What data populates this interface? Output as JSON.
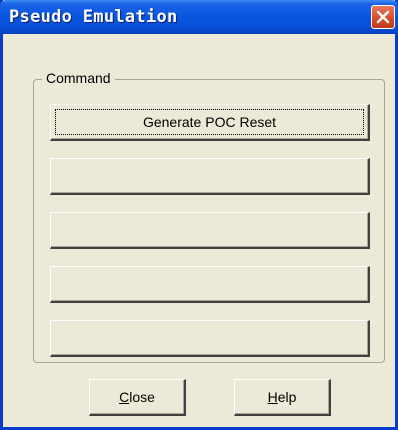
{
  "window": {
    "title": "Pseudo Emulation",
    "close_icon": "close-x-icon"
  },
  "command_group": {
    "label": "Command",
    "buttons": [
      {
        "label": "Generate POC Reset",
        "focused": true
      },
      {
        "label": ""
      },
      {
        "label": ""
      },
      {
        "label": ""
      },
      {
        "label": ""
      }
    ]
  },
  "footer": {
    "close": {
      "mnemonic": "C",
      "rest": "lose"
    },
    "help": {
      "mnemonic": "H",
      "rest": "elp"
    }
  },
  "colors": {
    "titlebar": "#0855dd",
    "dialog_bg": "#ece9d8",
    "close_red": "#d8522f"
  }
}
